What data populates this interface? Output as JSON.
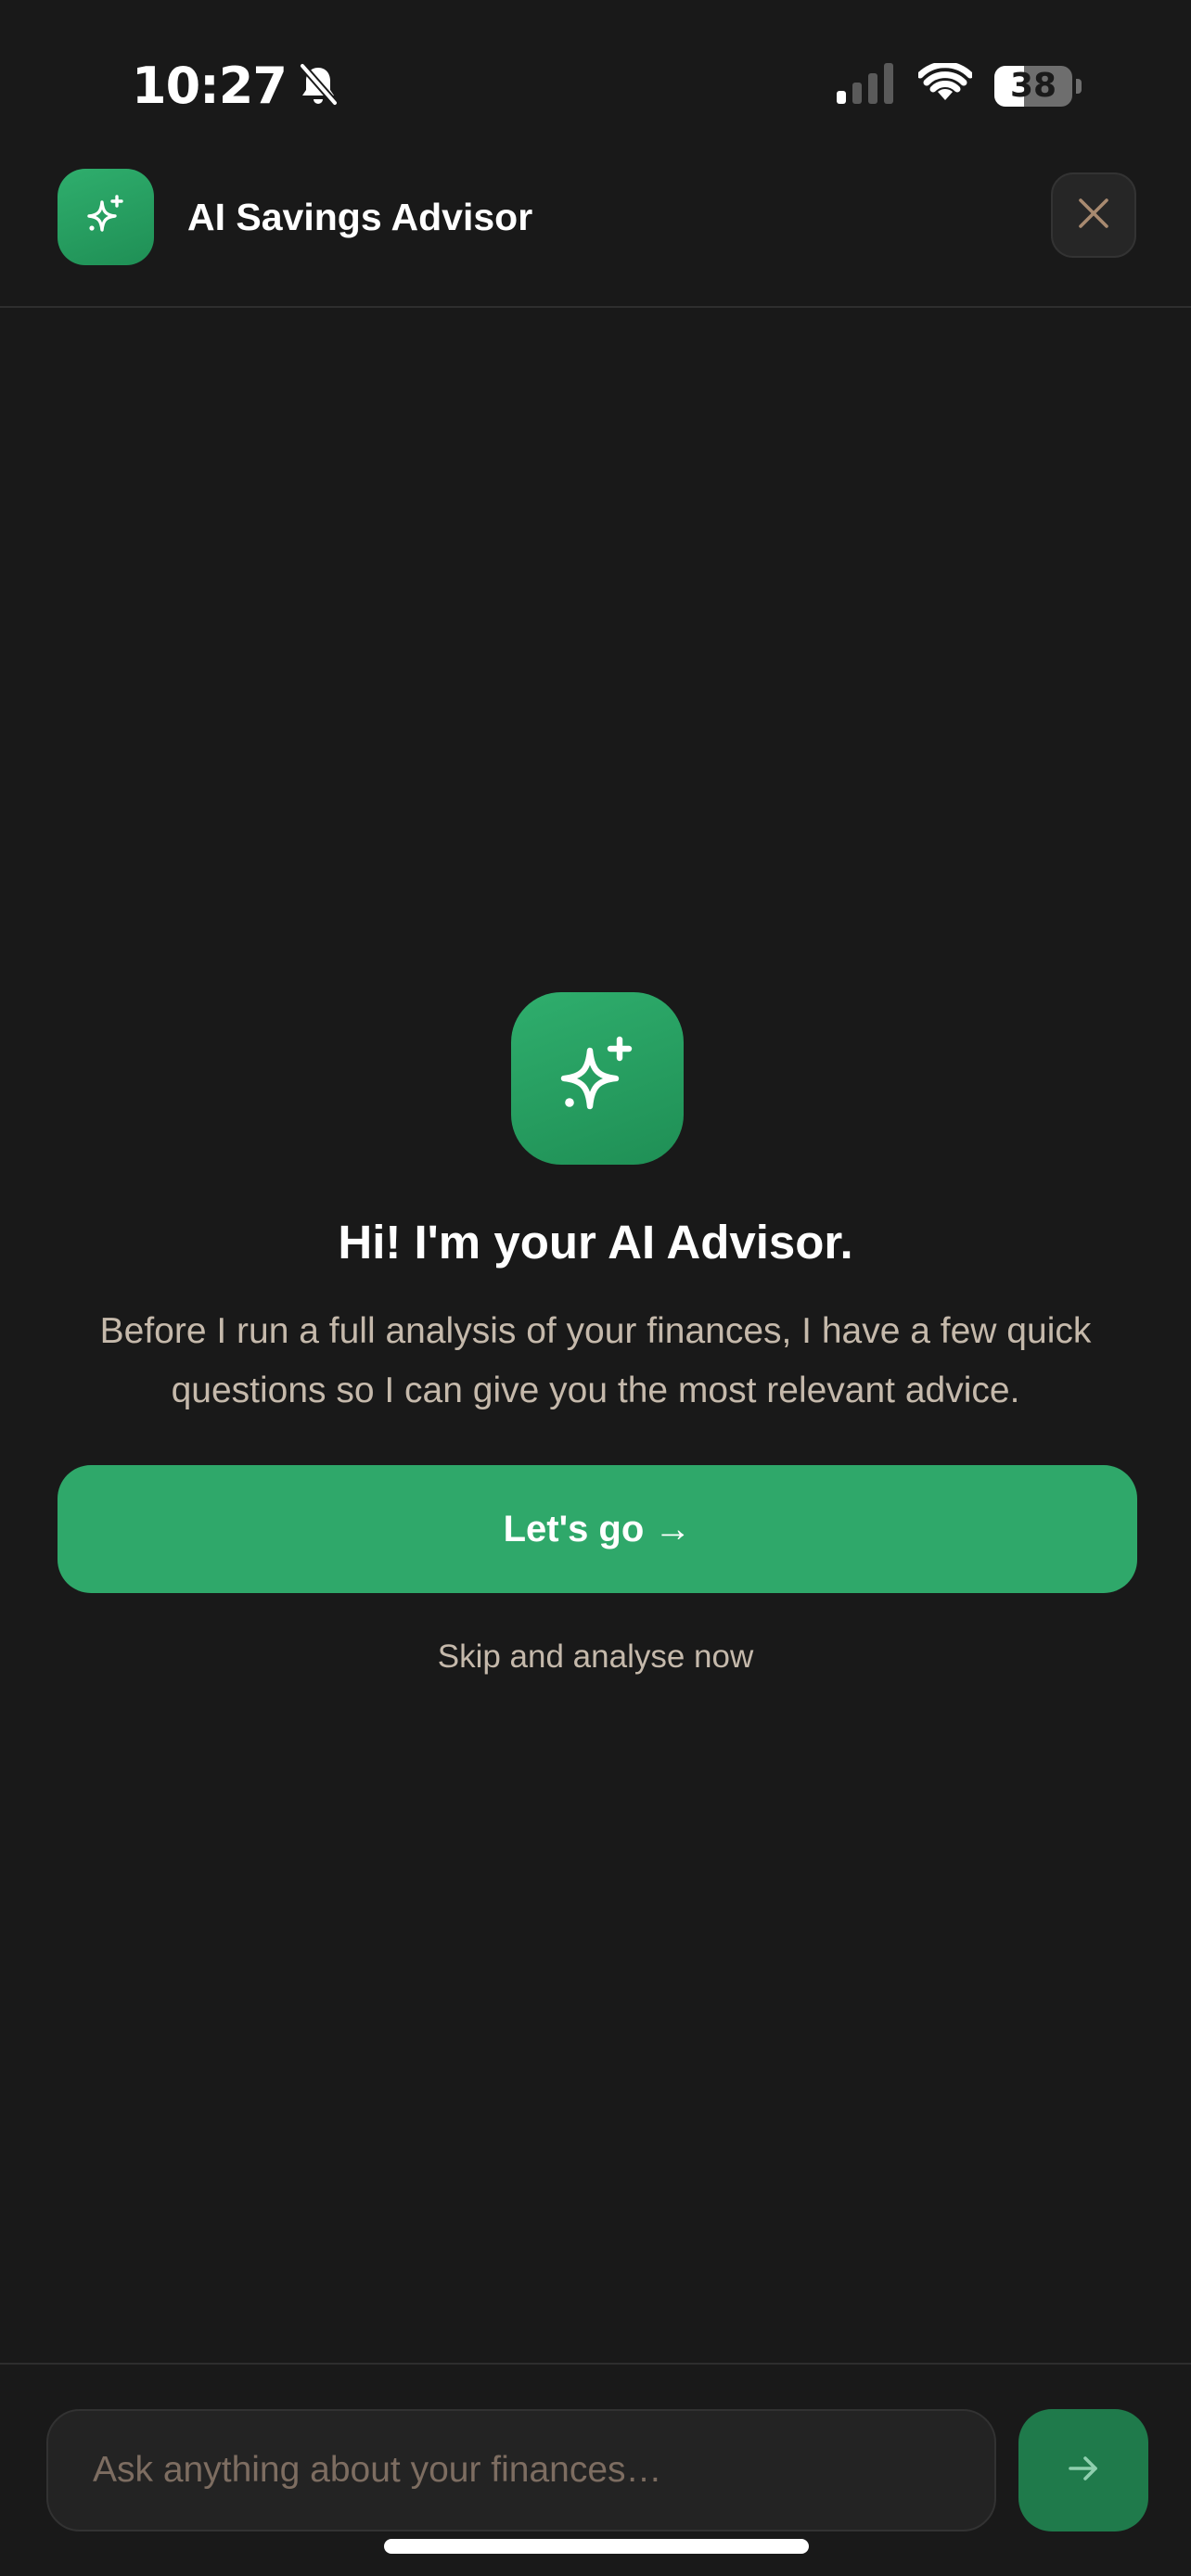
{
  "status_bar": {
    "time": "10:27",
    "battery_level": "38",
    "battery_fraction": 0.38,
    "silent_icon": "bell-slash-icon",
    "signal_icon": "cellular-signal-icon",
    "wifi_icon": "wifi-icon"
  },
  "header": {
    "title": "AI Savings Advisor",
    "logo_icon": "sparkles-icon",
    "close_icon": "close-icon"
  },
  "hero": {
    "icon": "sparkles-icon",
    "title": "Hi! I'm your AI Advisor.",
    "description": "Before I run a full analysis of your finances, I have a few quick questions so I can give you the most relevant advice.",
    "primary_button_label": "Let's go →",
    "skip_link_label": "Skip and analyse now"
  },
  "composer": {
    "input_value": "",
    "placeholder": "Ask anything about your finances…",
    "send_icon": "arrow-right-icon"
  },
  "colors": {
    "background": "#191919",
    "accent": "#2fa86a",
    "accent_dark": "#1f7a4b",
    "muted_text": "#c5b9ab",
    "placeholder_text": "#7d6d61",
    "close_icon": "#a88a70"
  }
}
